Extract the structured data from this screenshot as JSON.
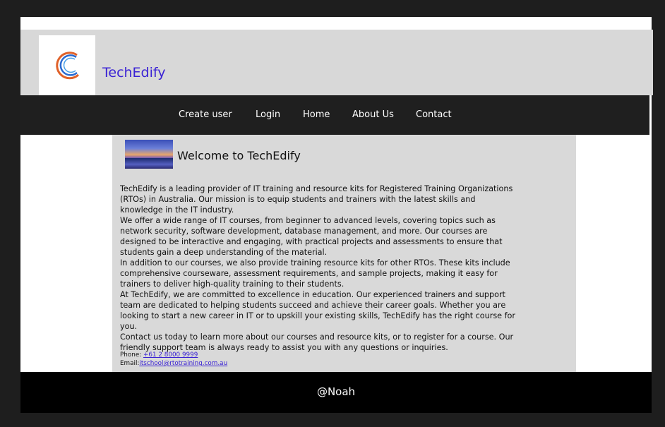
{
  "header": {
    "brand": "TechEdify",
    "logo_icon": "crescent-swirl-logo"
  },
  "nav": {
    "items": [
      "Create user",
      "Login",
      "Home",
      "About Us",
      "Contact"
    ]
  },
  "main": {
    "welcome": "Welcome to TechEdify",
    "paragraphs": [
      "TechEdify is a leading provider of IT training and resource kits for Registered Training Organizations (RTOs) in Australia. Our mission is to equip students and trainers with the latest skills and knowledge in the IT industry.",
      "We offer a wide range of IT courses, from beginner to advanced levels, covering topics such as network security, software development, database management, and more. Our courses are designed to be interactive and engaging, with practical projects and assessments to ensure that students gain a deep understanding of the material.",
      "In addition to our courses, we also provide training resource kits for other RTOs. These kits include comprehensive courseware, assessment requirements, and sample projects, making it easy for trainers to deliver high-quality training to their students.",
      "At TechEdify, we are committed to excellence in education. Our experienced trainers and support team are dedicated to helping students succeed and achieve their career goals. Whether you are looking to start a new career in IT or to upskill your existing skills, TechEdify has the right course for you.",
      "Contact us today to learn more about our courses and resource kits, or to register for a course. Our friendly support team is always ready to assist you with any questions or inquiries."
    ],
    "phone_label": "Phone: ",
    "phone": "+61 2 8000 9999",
    "email_label": "Email:",
    "email": "itschool@rtotraining.com.au"
  },
  "footer": {
    "text": "@Noah"
  },
  "colors": {
    "brand": "#3a22d4",
    "nav_bg": "#1f1f1f",
    "content_bg": "#d9d9d9",
    "footer_bg": "#000000"
  }
}
